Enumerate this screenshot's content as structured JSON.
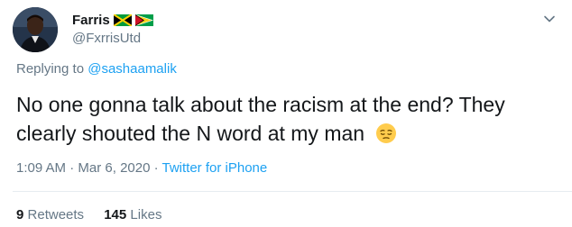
{
  "author": {
    "display_name": "Farris",
    "handle": "@FxrrisUtd",
    "flags": [
      "jamaica-flag",
      "guyana-flag"
    ]
  },
  "reply": {
    "prefix": "Replying to ",
    "mention": "@sashaamalik"
  },
  "tweet": {
    "text": "No one gonna talk about the racism at the end? They clearly shouted the N word at my man",
    "emoji": "pensive-face-emoji"
  },
  "meta": {
    "time": "1:09 AM",
    "separator1": " · ",
    "date": "Mar 6, 2020",
    "separator2": " · ",
    "source": "Twitter for iPhone"
  },
  "stats": {
    "retweets_count": "9",
    "retweets_label": "Retweets",
    "likes_count": "145",
    "likes_label": "Likes"
  },
  "colors": {
    "link": "#1da1f2",
    "secondary_text": "#657786",
    "primary_text": "#14171a"
  }
}
